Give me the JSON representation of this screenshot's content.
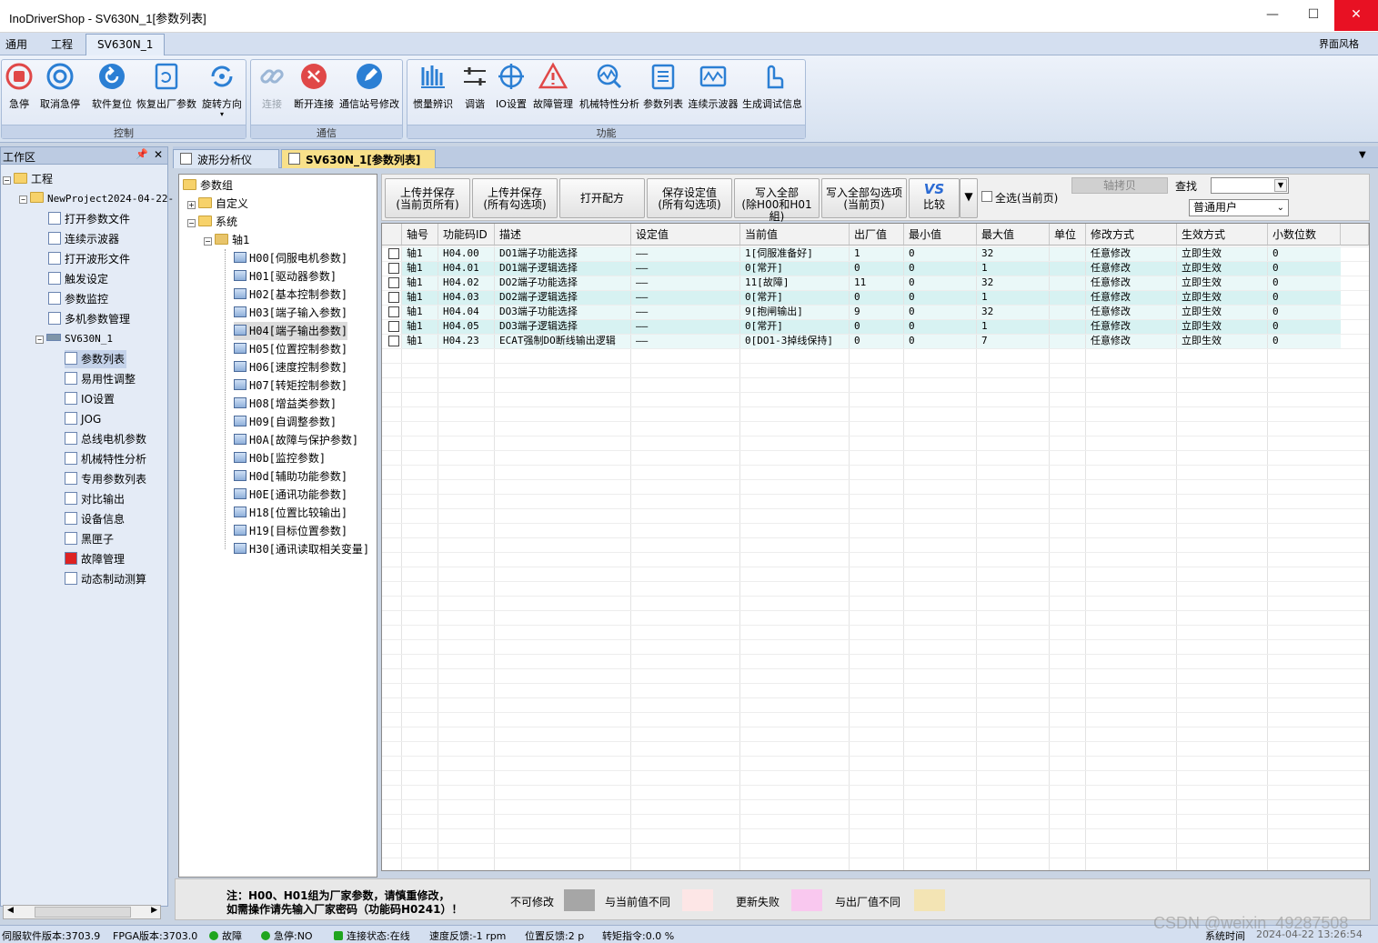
{
  "window": {
    "title": "InoDriverShop - SV630N_1[参数列表]",
    "min": "—",
    "max": "☐",
    "close": "✕"
  },
  "menu": {
    "tabs": [
      "通用",
      "工程",
      "SV630N_1"
    ],
    "right": "界面风格"
  },
  "ribbon": {
    "groups": [
      {
        "label": "控制",
        "buttons": [
          "急停",
          "取消急停",
          "软件复位",
          "恢复出厂参数",
          "旋转方向"
        ]
      },
      {
        "label": "通信",
        "buttons": [
          "连接",
          "断开连接",
          "通信站号修改"
        ]
      },
      {
        "label": "功能",
        "buttons": [
          "惯量辨识",
          "调谐",
          "IO设置",
          "故障管理",
          "机械特性分析",
          "参数列表",
          "连续示波器",
          "生成调试信息"
        ]
      }
    ]
  },
  "workspace": {
    "title": "工作区",
    "pin": "📌",
    "close": "✕",
    "root": "工程",
    "project": "NewProject2024-04-22-",
    "items": [
      "打开参数文件",
      "连续示波器",
      "打开波形文件",
      "触发设定",
      "参数监控",
      "多机参数管理"
    ],
    "device": "SV630N_1",
    "device_items": [
      "参数列表",
      "易用性调整",
      "IO设置",
      "JOG",
      "总线电机参数",
      "机械特性分析",
      "专用参数列表",
      "对比输出",
      "设备信息",
      "黑匣子",
      "故障管理",
      "动态制动测算"
    ]
  },
  "doc_tabs": [
    "波形分析仪",
    "SV630N_1[参数列表]"
  ],
  "tree": {
    "root": "参数组",
    "custom": "自定义",
    "system": "系统",
    "axis": "轴1",
    "groups": [
      "H00[伺服电机参数]",
      "H01[驱动器参数]",
      "H02[基本控制参数]",
      "H03[端子输入参数]",
      "H04[端子输出参数]",
      "H05[位置控制参数]",
      "H06[速度控制参数]",
      "H07[转矩控制参数]",
      "H08[增益类参数]",
      "H09[自调整参数]",
      "H0A[故障与保护参数]",
      "H0b[监控参数]",
      "H0d[辅助功能参数]",
      "H0E[通讯功能参数]",
      "H18[位置比较输出]",
      "H19[目标位置参数]",
      "H30[通讯读取相关变量]"
    ]
  },
  "toolbar": {
    "buttons": [
      {
        "l1": "上传并保存",
        "l2": "(当前页所有)"
      },
      {
        "l1": "上传并保存",
        "l2": "(所有勾选项)"
      },
      {
        "l1": "打开配方",
        "l2": ""
      },
      {
        "l1": "保存设定值",
        "l2": "(所有勾选项)"
      },
      {
        "l1": "写入全部",
        "l2": "(除H00和H01組)"
      },
      {
        "l1": "写入全部勾选项",
        "l2": "(当前页)"
      }
    ],
    "compare_icon": "VS",
    "compare": "比较",
    "select_all": "全选(当前页)",
    "axis_copy": "轴拷贝",
    "search": "查找",
    "search_value": "",
    "user_level": "普通用户"
  },
  "table": {
    "columns": [
      "轴号",
      "功能码ID",
      "描述",
      "设定值",
      "当前值",
      "出厂值",
      "最小值",
      "最大值",
      "单位",
      "修改方式",
      "生效方式",
      "小数位数"
    ],
    "rows": [
      [
        "轴1",
        "H04.00",
        "DO1端子功能选择",
        "——",
        "1[伺服准备好]",
        "1",
        "0",
        "32",
        "",
        "任意修改",
        "立即生效",
        "0"
      ],
      [
        "轴1",
        "H04.01",
        "DO1端子逻辑选择",
        "——",
        "0[常开]",
        "0",
        "0",
        "1",
        "",
        "任意修改",
        "立即生效",
        "0"
      ],
      [
        "轴1",
        "H04.02",
        "DO2端子功能选择",
        "——",
        "11[故障]",
        "11",
        "0",
        "32",
        "",
        "任意修改",
        "立即生效",
        "0"
      ],
      [
        "轴1",
        "H04.03",
        "DO2端子逻辑选择",
        "——",
        "0[常开]",
        "0",
        "0",
        "1",
        "",
        "任意修改",
        "立即生效",
        "0"
      ],
      [
        "轴1",
        "H04.04",
        "DO3端子功能选择",
        "——",
        "9[抱闸输出]",
        "9",
        "0",
        "32",
        "",
        "任意修改",
        "立即生效",
        "0"
      ],
      [
        "轴1",
        "H04.05",
        "DO3端子逻辑选择",
        "——",
        "0[常开]",
        "0",
        "0",
        "1",
        "",
        "任意修改",
        "立即生效",
        "0"
      ],
      [
        "轴1",
        "H04.23",
        "ECAT强制DO断线输出逻辑",
        "——",
        "0[DO1-3掉线保持]",
        "0",
        "0",
        "7",
        "",
        "任意修改",
        "立即生效",
        "0"
      ]
    ]
  },
  "footer": {
    "note1": "注：H00、H01组为厂家参数，请慎重修改，",
    "note2": "如需操作请先输入厂家密码（功能码H0241）！",
    "legend": [
      {
        "label": "不可修改",
        "color": "#a6a6a6"
      },
      {
        "label": "与当前值不同",
        "color": "#fde6e6"
      },
      {
        "label": "更新失败",
        "color": "#f9c8ef"
      },
      {
        "label": "与出厂值不同",
        "color": "#f3e4b4"
      }
    ]
  },
  "status": {
    "items": [
      "伺服软件版本:3703.9",
      "FPGA版本:3703.0",
      "故障",
      "急停:NO",
      "连接状态:在线",
      "速度反馈:-1 rpm",
      "位置反馈:2 p",
      "转矩指令:0.0 %",
      "系统时间",
      "2024-04-22 13:26:54"
    ]
  },
  "watermark": "CSDN @weixin_49287508",
  "colors": {
    "row_even": "#ffffff",
    "row_odd": "#d7f2f2",
    "row_alt2": "#eaf8f8",
    "active_tab": "#f8e08a",
    "ribbon_bg": "#dfe7f4"
  }
}
